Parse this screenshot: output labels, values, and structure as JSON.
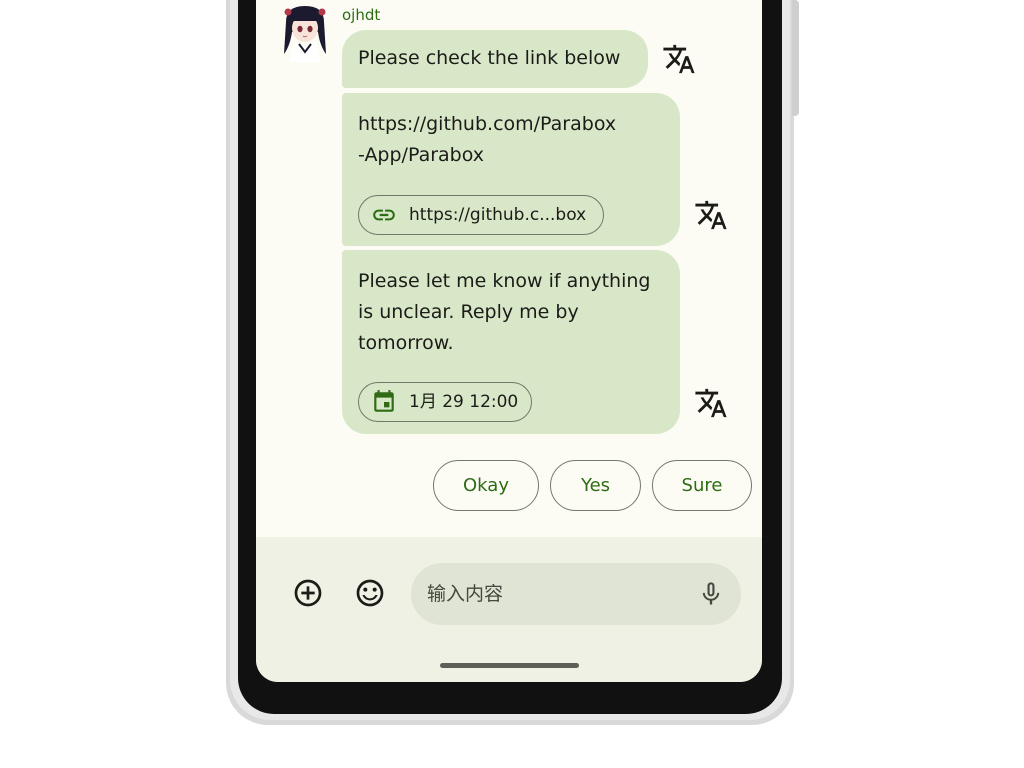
{
  "chat": {
    "sender_name": "ojhdt",
    "messages": [
      {
        "text": "Please check the link below"
      },
      {
        "text_line1": "https://github.com/Parabox",
        "text_line2": "-App/Parabox",
        "link_chip": "https://github.c...box"
      },
      {
        "text_line1": "Please let me know if anything",
        "text_line2": "is unclear. Reply me by",
        "text_line3": "tomorrow.",
        "date_chip": "1月 29 12:00"
      }
    ]
  },
  "smart_replies": [
    "Okay",
    "Yes",
    "Sure"
  ],
  "composer": {
    "placeholder": "输入内容"
  },
  "colors": {
    "bubble": "#d9e7c9",
    "accent": "#2e6b14",
    "screen_bg": "#fcfcf4",
    "composer_bg": "#eef1e3"
  },
  "icons": [
    "avatar",
    "translate-icon",
    "link-icon",
    "calendar-icon",
    "add-circle-icon",
    "emoji-icon",
    "mic-icon"
  ]
}
